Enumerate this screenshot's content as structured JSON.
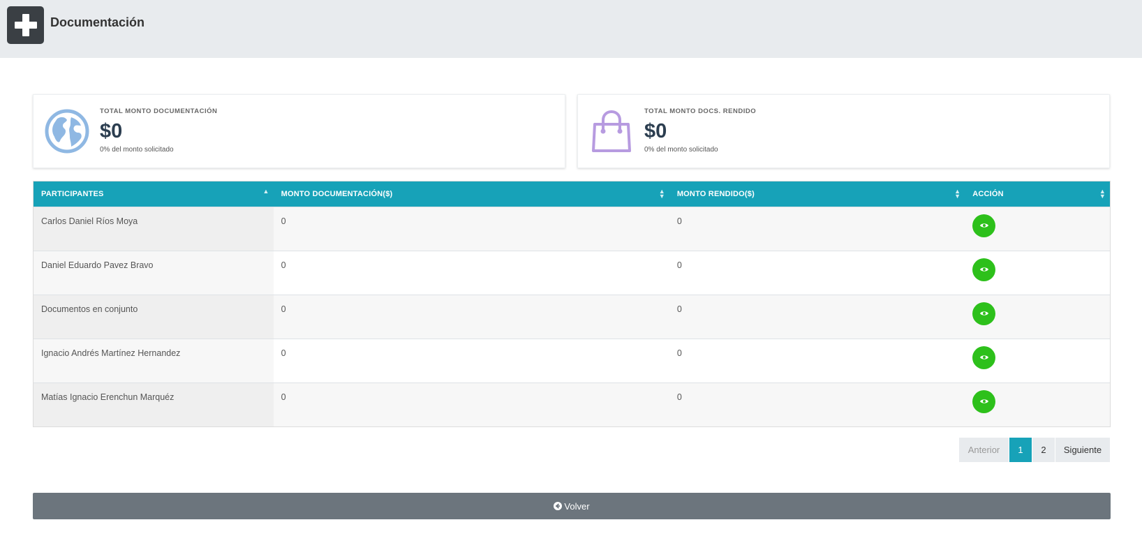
{
  "header": {
    "title": "Documentación",
    "logo_icon": "plus-icon"
  },
  "cards": [
    {
      "icon": "globe-icon",
      "icon_color": "#8fb8e3",
      "label": "TOTAL MONTO DOCUMENTACIÓN",
      "value": "$0",
      "sub": "0% del monto solicitado"
    },
    {
      "icon": "shopping-bag-icon",
      "icon_color": "#b79be0",
      "label": "TOTAL MONTO DOCS. RENDIDO",
      "value": "$0",
      "sub": "0% del monto solicitado"
    }
  ],
  "table": {
    "header_color": "#17a2b8",
    "columns": [
      "PARTICIPANTES",
      "MONTO DOCUMENTACIÓN($)",
      "MONTO RENDIDO($)",
      "ACCIÓN"
    ],
    "rows": [
      {
        "participante": "Carlos Daniel Ríos Moya",
        "monto_documentacion": "0",
        "monto_rendido": "0"
      },
      {
        "participante": "Daniel Eduardo Pavez Bravo",
        "monto_documentacion": "0",
        "monto_rendido": "0"
      },
      {
        "participante": "Documentos en conjunto",
        "monto_documentacion": "0",
        "monto_rendido": "0"
      },
      {
        "participante": "Ignacio Andrés Martínez Hernandez",
        "monto_documentacion": "0",
        "monto_rendido": "0"
      },
      {
        "participante": "Matías Ignacio Erenchun Marquéz",
        "monto_documentacion": "0",
        "monto_rendido": "0"
      }
    ],
    "action_icon": "eye-icon",
    "action_color": "#2dc01b"
  },
  "pagination": {
    "prev": "Anterior",
    "pages": [
      "1",
      "2"
    ],
    "active_page": "1",
    "next": "Siguiente"
  },
  "back_button": {
    "label": "Volver",
    "icon": "arrow-circle-left-icon"
  }
}
